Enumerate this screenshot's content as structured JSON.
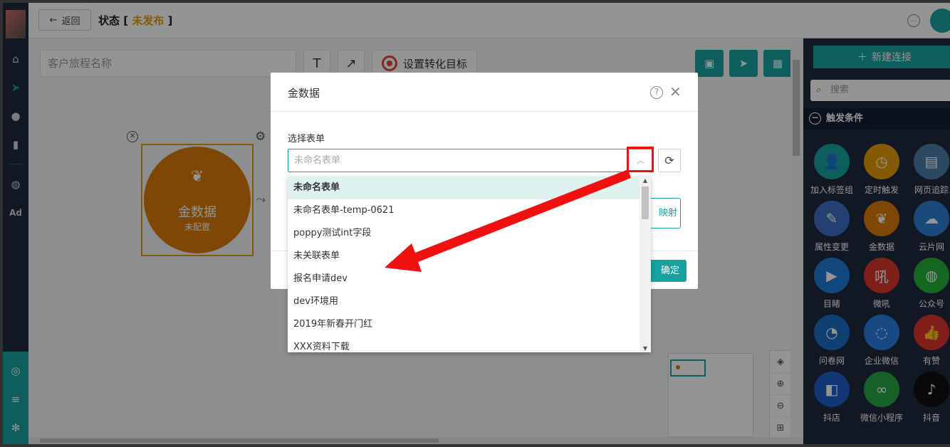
{
  "topbar": {
    "back_label": "返回",
    "status_prefix": "状态 [ ",
    "status_value": "未发布",
    "status_suffix": " ]"
  },
  "toolbar": {
    "journey_name_placeholder": "客户旅程名称",
    "text_tool": "T",
    "arrow_tool": "↗",
    "conversion_label": "设置转化目标"
  },
  "node": {
    "name": "金数据",
    "status": "未配置"
  },
  "right_panel": {
    "new_connection_label": "新建连接",
    "search_placeholder": "搜索",
    "section_title": "触发条件",
    "triggers": [
      {
        "label": "加入标签组",
        "color": "#17a2a0",
        "icon": "user-plus-icon"
      },
      {
        "label": "定时触发",
        "color": "#e39b0a",
        "icon": "clock-icon"
      },
      {
        "label": "网页追踪",
        "color": "#4e7fa8",
        "icon": "webpage-icon"
      },
      {
        "label": "属性变更",
        "color": "#3f6dc4",
        "icon": "edit-icon"
      },
      {
        "label": "金数据",
        "color": "#d97a0a",
        "icon": "leaf-icon"
      },
      {
        "label": "云片网",
        "color": "#2d7fd4",
        "icon": "cloud-icon"
      },
      {
        "label": "目睹",
        "color": "#1f7ad8",
        "icon": "play-icon"
      },
      {
        "label": "微吼",
        "color": "#d9372c",
        "icon": "weihou-icon"
      },
      {
        "label": "公众号",
        "color": "#25b03a",
        "icon": "wechat-icon"
      },
      {
        "label": "问卷网",
        "color": "#1d6fc4",
        "icon": "survey-icon"
      },
      {
        "label": "企业微信",
        "color": "#2b7fe0",
        "icon": "wecom-icon"
      },
      {
        "label": "有赞",
        "color": "#e0352b",
        "icon": "thumb-icon"
      },
      {
        "label": "抖店",
        "color": "#1f5ec8",
        "icon": "doudian-icon"
      },
      {
        "label": "微信小程序",
        "color": "#27a844",
        "icon": "miniprogram-icon"
      },
      {
        "label": "抖音",
        "color": "#111111",
        "icon": "tiktok-icon"
      }
    ]
  },
  "dialog": {
    "title": "金数据",
    "field_label": "选择表单",
    "select_placeholder": "未命名表单",
    "map_button_label": "映射",
    "ok_label": "确定"
  },
  "dropdown": {
    "options": [
      "未命名表单",
      "未命名表单-temp-0621",
      "poppy测试int字段",
      "未关联表单",
      "报名申请dev",
      "dev环境用",
      "2019年新春开门红",
      "XXX资料下载"
    ]
  },
  "colors": {
    "accent": "#17a2a0",
    "node": "#d97a0a",
    "status_flag": "#e39b0a",
    "highlight": "#f01010"
  }
}
